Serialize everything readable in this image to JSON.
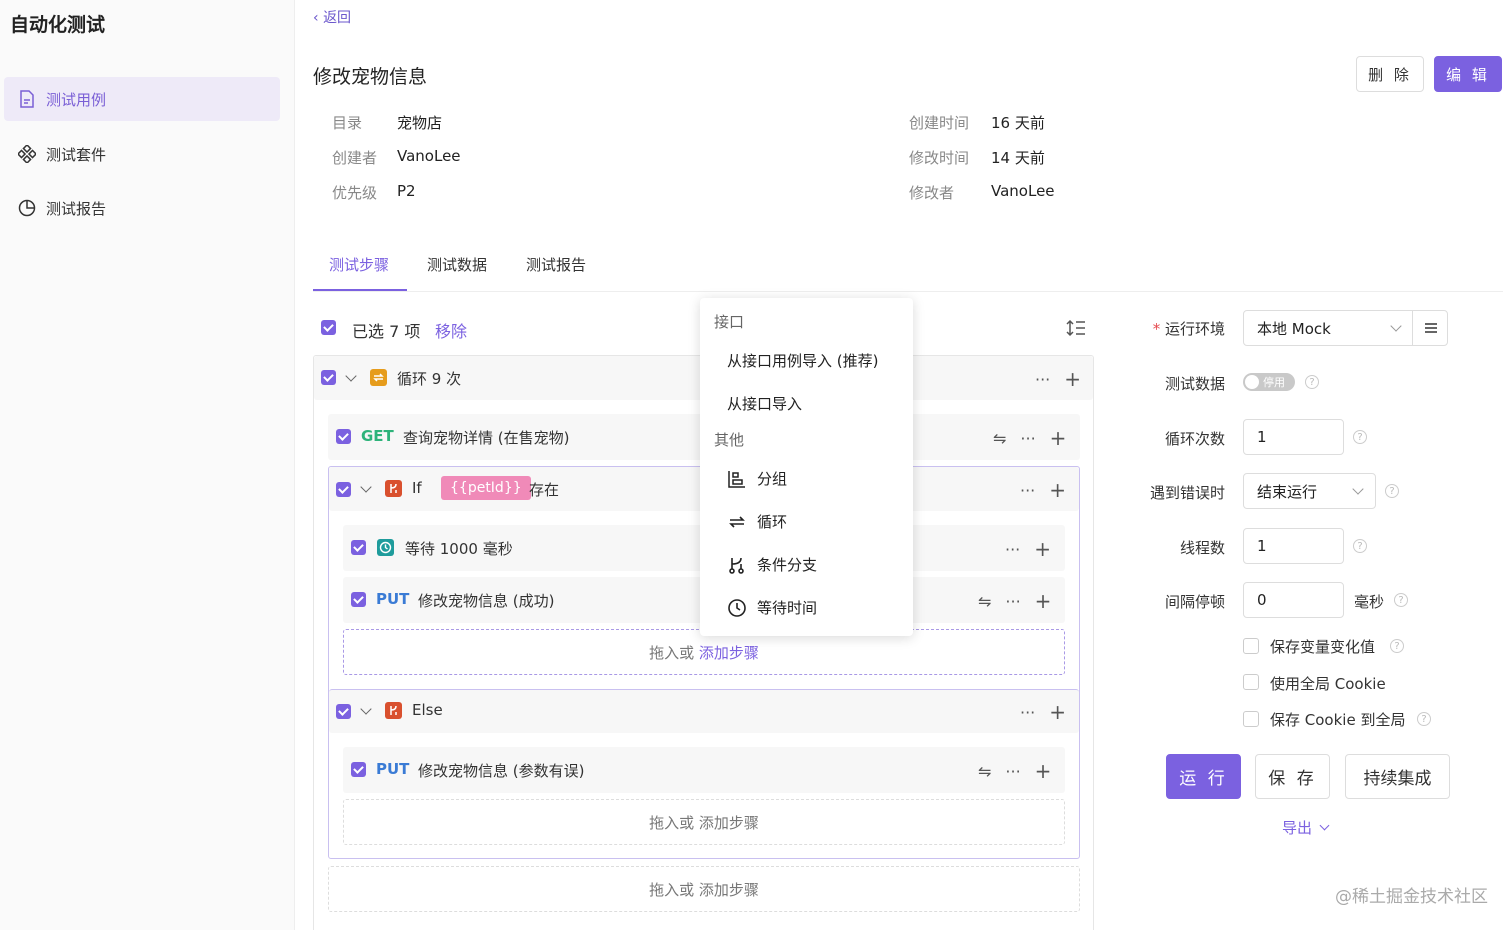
{
  "sidebar": {
    "app_title": "自动化测试",
    "items": [
      {
        "label": "测试用例",
        "icon": "document-icon"
      },
      {
        "label": "测试套件",
        "icon": "components-icon"
      },
      {
        "label": "测试报告",
        "icon": "pie-chart-icon"
      }
    ]
  },
  "header": {
    "back": "返回",
    "title": "修改宠物信息",
    "delete_label": "删 除",
    "edit_label": "编 辑"
  },
  "meta": {
    "dir_label": "目录",
    "dir_value": "宠物店",
    "creator_label": "创建者",
    "creator_value": "VanoLee",
    "priority_label": "优先级",
    "priority_value": "P2",
    "created_label": "创建时间",
    "created_value": "16 天前",
    "modified_label": "修改时间",
    "modified_value": "14 天前",
    "modifier_label": "修改者",
    "modifier_value": "VanoLee"
  },
  "tabs": [
    "测试步骤",
    "测试数据",
    "测试报告"
  ],
  "steps": {
    "selected_text": "已选 7 项",
    "remove_label": "移除",
    "loop_label": "循环 9 次",
    "get_method": "GET",
    "get_name": "查询宠物详情 (在售宠物)",
    "if_label": "If",
    "if_var": "{{petId}}",
    "if_cond": "存在",
    "wait_label": "等待 1000 毫秒",
    "put_method": "PUT",
    "put_name_1": "修改宠物信息 (成功)",
    "drop_text": "拖入或",
    "add_step": "添加步骤",
    "else_label": "Else",
    "put_name_2": "修改宠物信息 (参数有误)",
    "drop_full": "拖入或 添加步骤"
  },
  "popup": {
    "group_api": "接口",
    "import_case": "从接口用例导入 (推荐)",
    "import_api": "从接口导入",
    "group_other": "其他",
    "group_item": "分组",
    "loop_item": "循环",
    "branch_item": "条件分支",
    "wait_item": "等待时间"
  },
  "form": {
    "required_mark": "*",
    "env_label": "运行环境",
    "env_value": "本地 Mock",
    "data_label": "测试数据",
    "data_switch": "停用",
    "loop_label": "循环次数",
    "loop_value": "1",
    "error_label": "遇到错误时",
    "error_value": "结束运行",
    "threads_label": "线程数",
    "threads_value": "1",
    "interval_label": "间隔停顿",
    "interval_value": "0",
    "interval_unit": "毫秒",
    "opt_save_var": "保存变量变化值",
    "opt_global_cookie": "使用全局 Cookie",
    "opt_save_cookie": "保存 Cookie 到全局",
    "run_label": "运 行",
    "save_label": "保 存",
    "ci_label": "持续集成",
    "export_label": "导出"
  },
  "watermark": "@稀土掘金技术社区",
  "colors": {
    "accent": "#7b61e0",
    "get": "#2db37a",
    "put": "#3a7bd5",
    "loop": "#e69c1c",
    "branch": "#d9502e",
    "wait": "#1f9c9c",
    "var_tag": "#f08ab8"
  }
}
